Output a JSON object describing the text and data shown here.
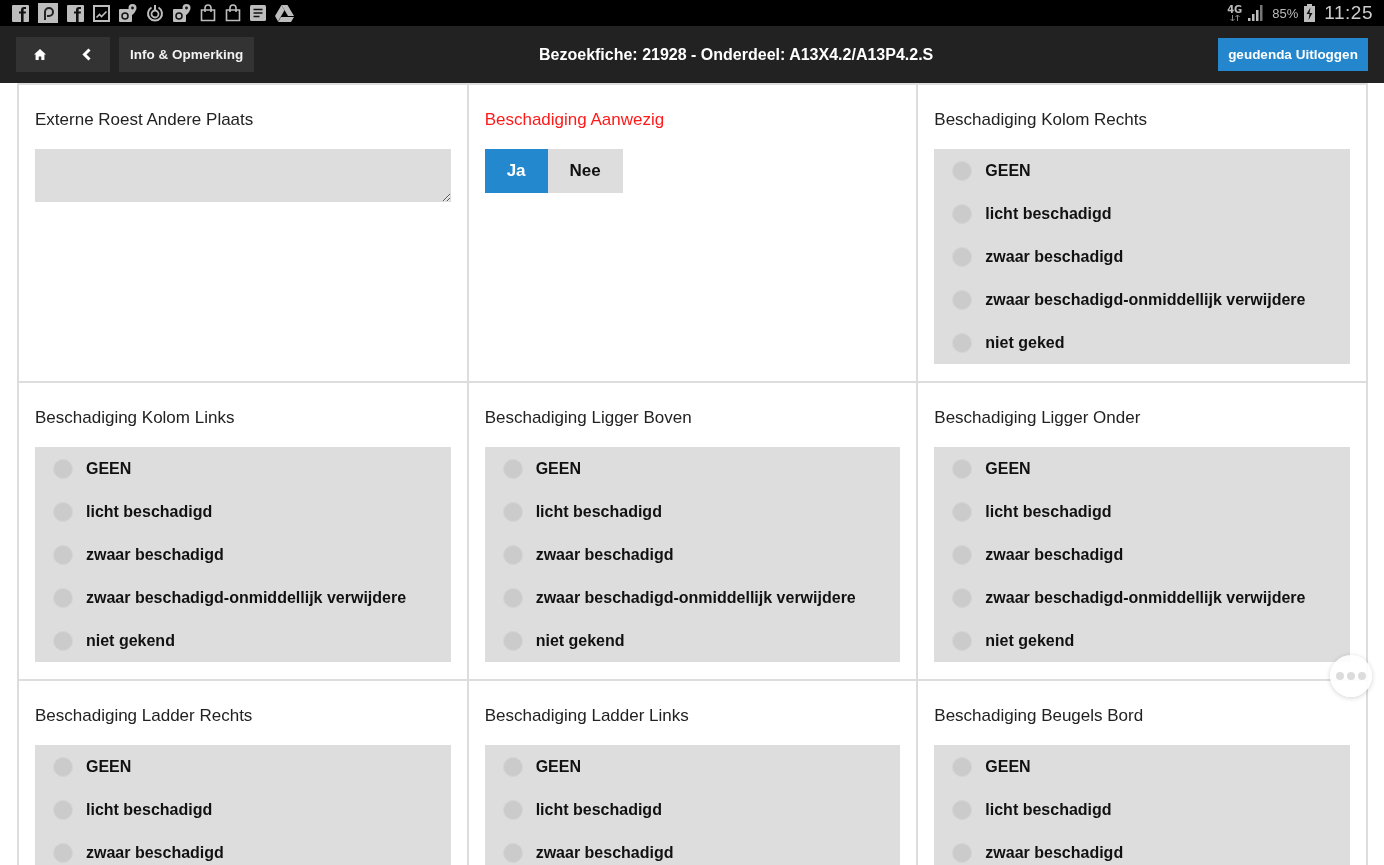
{
  "status_bar": {
    "network": "4G",
    "battery": "85%",
    "time": "11:25"
  },
  "header": {
    "info_button": "Info & Opmerking",
    "title": "Bezoekfiche: 21928 - Onderdeel: A13X4.2/A13P4.2.S",
    "logout_button": "geudenda Uitloggen"
  },
  "fields": [
    {
      "kind": "textarea",
      "label": "Externe Roest Andere Plaats",
      "highlighted": false
    },
    {
      "kind": "toggle",
      "label": "Beschadiging Aanwezig",
      "highlighted": true,
      "options": [
        {
          "label": "Ja",
          "selected": true
        },
        {
          "label": "Nee",
          "selected": false
        }
      ]
    },
    {
      "kind": "radio",
      "label": "Beschadiging Kolom Rechts",
      "highlighted": false,
      "options": [
        {
          "label": "GEEN",
          "selected": false
        },
        {
          "label": "licht beschadigd",
          "selected": false
        },
        {
          "label": "zwaar beschadigd",
          "selected": false
        },
        {
          "label": "zwaar beschadigd-onmiddellijk verwijdere",
          "selected": false
        },
        {
          "label": "niet geked",
          "selected": false
        }
      ]
    },
    {
      "kind": "radio",
      "label": "Beschadiging Kolom Links",
      "highlighted": false,
      "options": [
        {
          "label": "GEEN",
          "selected": false
        },
        {
          "label": "licht beschadigd",
          "selected": false
        },
        {
          "label": "zwaar beschadigd",
          "selected": false
        },
        {
          "label": "zwaar beschadigd-onmiddellijk verwijdere",
          "selected": false
        },
        {
          "label": "niet gekend",
          "selected": false
        }
      ]
    },
    {
      "kind": "radio",
      "label": "Beschadiging Ligger Boven",
      "highlighted": false,
      "options": [
        {
          "label": "GEEN",
          "selected": false
        },
        {
          "label": "licht beschadigd",
          "selected": false
        },
        {
          "label": "zwaar beschadigd",
          "selected": false
        },
        {
          "label": "zwaar beschadigd-onmiddellijk verwijdere",
          "selected": false
        },
        {
          "label": "niet gekend",
          "selected": false
        }
      ]
    },
    {
      "kind": "radio",
      "label": "Beschadiging Ligger Onder",
      "highlighted": false,
      "options": [
        {
          "label": "GEEN",
          "selected": false
        },
        {
          "label": "licht beschadigd",
          "selected": false
        },
        {
          "label": "zwaar beschadigd",
          "selected": false
        },
        {
          "label": "zwaar beschadigd-onmiddellijk verwijdere",
          "selected": false
        },
        {
          "label": "niet gekend",
          "selected": false
        }
      ]
    },
    {
      "kind": "radio",
      "label": "Beschadiging Ladder Rechts",
      "highlighted": false,
      "options": [
        {
          "label": "GEEN",
          "selected": false
        },
        {
          "label": "licht beschadigd",
          "selected": false
        },
        {
          "label": "zwaar beschadigd",
          "selected": false
        }
      ]
    },
    {
      "kind": "radio",
      "label": "Beschadiging Ladder Links",
      "highlighted": false,
      "options": [
        {
          "label": "GEEN",
          "selected": false
        },
        {
          "label": "licht beschadigd",
          "selected": false
        },
        {
          "label": "zwaar beschadigd",
          "selected": false
        }
      ]
    },
    {
      "kind": "radio",
      "label": "Beschadiging Beugels Bord",
      "highlighted": false,
      "options": [
        {
          "label": "GEEN",
          "selected": false
        },
        {
          "label": "licht beschadigd",
          "selected": false
        },
        {
          "label": "zwaar beschadigd",
          "selected": false
        }
      ]
    }
  ]
}
